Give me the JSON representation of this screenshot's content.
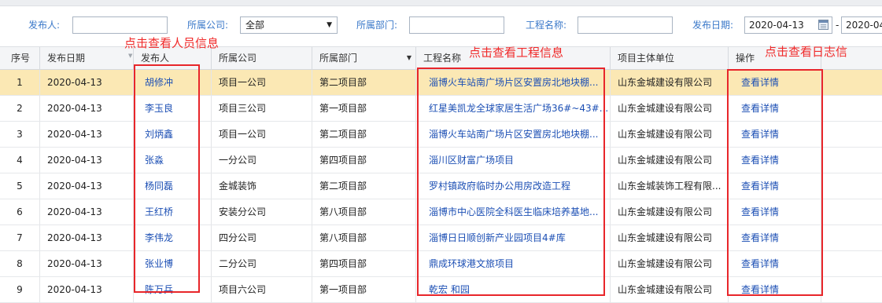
{
  "filters": {
    "publisher_label": "发布人:",
    "publisher_value": "",
    "company_label": "所属公司:",
    "company_selected": "全部",
    "department_label": "所属部门:",
    "department_value": "",
    "project_label": "工程名称:",
    "project_value": "",
    "date_label": "发布日期:",
    "date_from": "2020-04-13",
    "date_separator": "-",
    "date_to": "2020-04-"
  },
  "annotations": {
    "person": "点击查看人员信息",
    "project": "点击查看工程信息",
    "log": "点击查看日志信"
  },
  "table": {
    "headers": {
      "index": "序号",
      "date": "发布日期",
      "publisher": "发布人",
      "company": "所属公司",
      "department": "所属部门",
      "project": "工程名称",
      "unit": "项目主体单位",
      "action": "操作"
    },
    "rows": [
      {
        "index": "1",
        "date": "2020-04-13",
        "publisher": "胡修冲",
        "company": "项目一公司",
        "department": "第二项目部",
        "project": "淄博火车站南广场片区安置房北地块棚...",
        "unit": "山东金城建设有限公司",
        "action": "查看详情"
      },
      {
        "index": "2",
        "date": "2020-04-13",
        "publisher": "李玉良",
        "company": "项目三公司",
        "department": "第一项目部",
        "project": "红星美凯龙全球家居生活广场36#~43#...",
        "unit": "山东金城建设有限公司",
        "action": "查看详情"
      },
      {
        "index": "3",
        "date": "2020-04-13",
        "publisher": "刘炳鑫",
        "company": "项目一公司",
        "department": "第二项目部",
        "project": "淄博火车站南广场片区安置房北地块棚...",
        "unit": "山东金城建设有限公司",
        "action": "查看详情"
      },
      {
        "index": "4",
        "date": "2020-04-13",
        "publisher": "张淼",
        "company": "一分公司",
        "department": "第四项目部",
        "project": "淄川区财富广场项目",
        "unit": "山东金城建设有限公司",
        "action": "查看详情"
      },
      {
        "index": "5",
        "date": "2020-04-13",
        "publisher": "杨同磊",
        "company": "金城装饰",
        "department": "第二项目部",
        "project": "罗村镇政府临时办公用房改造工程",
        "unit": "山东金城装饰工程有限...",
        "action": "查看详情"
      },
      {
        "index": "6",
        "date": "2020-04-13",
        "publisher": "王红桥",
        "company": "安装分公司",
        "department": "第八项目部",
        "project": "淄博市中心医院全科医生临床培养基地...",
        "unit": "山东金城建设有限公司",
        "action": "查看详情"
      },
      {
        "index": "7",
        "date": "2020-04-13",
        "publisher": "李伟龙",
        "company": "四分公司",
        "department": "第八项目部",
        "project": "淄博日日顺创新产业园项目4#库",
        "unit": "山东金城建设有限公司",
        "action": "查看详情"
      },
      {
        "index": "8",
        "date": "2020-04-13",
        "publisher": "张业博",
        "company": "二分公司",
        "department": "第四项目部",
        "project": "鼎成环球港文旅项目",
        "unit": "山东金城建设有限公司",
        "action": "查看详情"
      },
      {
        "index": "9",
        "date": "2020-04-13",
        "publisher": "陈万兵",
        "company": "项目六公司",
        "department": "第一项目部",
        "project": "乾宏 和园",
        "unit": "山东金城建设有限公司",
        "action": "查看详情"
      }
    ]
  },
  "colors": {
    "link": "#1c4fb4",
    "label": "#3a78c9",
    "annotation": "#f02a2a",
    "selected_row": "#fbe8b4"
  }
}
